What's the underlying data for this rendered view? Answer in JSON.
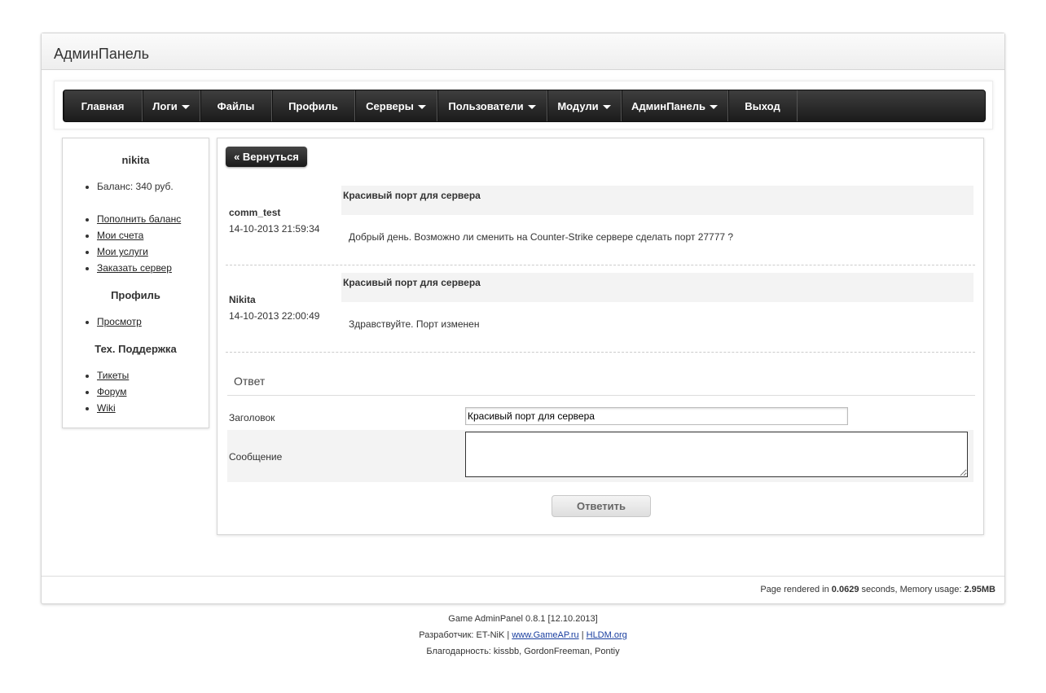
{
  "header": {
    "title": "АдминПанель"
  },
  "nav": {
    "items": [
      {
        "label": "Главная",
        "dropdown": false
      },
      {
        "label": "Логи",
        "dropdown": true
      },
      {
        "label": "Файлы",
        "dropdown": false
      },
      {
        "label": "Профиль",
        "dropdown": false
      },
      {
        "label": "Серверы",
        "dropdown": true
      },
      {
        "label": "Пользователи",
        "dropdown": true
      },
      {
        "label": "Модули",
        "dropdown": true
      },
      {
        "label": "АдминПанель",
        "dropdown": true
      },
      {
        "label": "Выход",
        "dropdown": false
      }
    ]
  },
  "sidebar": {
    "username": "nikita",
    "balance": "Баланс: 340 руб.",
    "account_links": [
      "Пополнить баланс",
      "Мои счета",
      "Мои услуги",
      "Заказать сервер"
    ],
    "profile_heading": "Профиль",
    "profile_links": [
      "Просмотр"
    ],
    "support_heading": "Тех. Поддержка",
    "support_links": [
      "Тикеты",
      "Форум",
      "Wiki"
    ]
  },
  "ticket": {
    "back_label": "« Вернуться",
    "messages": [
      {
        "author": "comm_test",
        "date": "14-10-2013 21:59:34",
        "subject": "Красивый порт для сервера",
        "text": "Добрый день. Возможно ли сменить на Counter-Strike сервере сделать порт 27777 ?"
      },
      {
        "author": "Nikita",
        "date": "14-10-2013 22:00:49",
        "subject": "Красивый порт для сервера",
        "text": "Здравствуйте. Порт изменен"
      }
    ]
  },
  "reply": {
    "heading": "Ответ",
    "title_label": "Заголовок",
    "title_value": "Красивый порт для сервера",
    "message_label": "Сообщение",
    "message_value": "",
    "submit_label": "Ответить"
  },
  "render_info": {
    "prefix": "Page rendered in",
    "time": "0.0629",
    "middle": "seconds, Memory usage:",
    "memory": "2.95MB"
  },
  "footer": {
    "version": "Game AdminPanel 0.8.1 [12.10.2013]",
    "dev_prefix": "Разработчик: ET-NiK |",
    "link1": "www.GameAP.ru",
    "separator": "|",
    "link2": "HLDM.org",
    "thanks": "Благодарность: kissbb, GordonFreeman, Pontiy"
  }
}
